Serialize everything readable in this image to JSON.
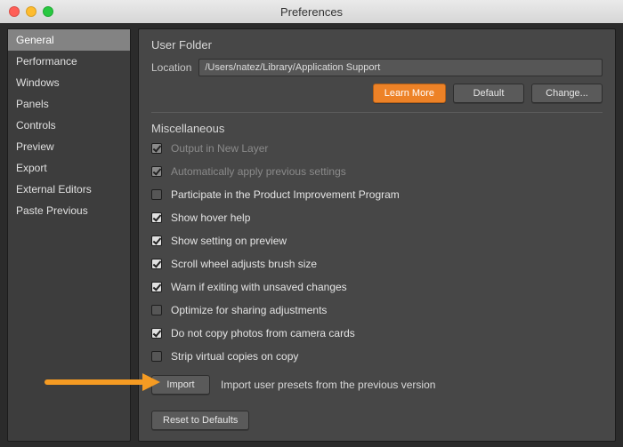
{
  "window": {
    "title": "Preferences"
  },
  "sidebar": {
    "items": [
      {
        "label": "General",
        "selected": true
      },
      {
        "label": "Performance"
      },
      {
        "label": "Windows"
      },
      {
        "label": "Panels"
      },
      {
        "label": "Controls"
      },
      {
        "label": "Preview"
      },
      {
        "label": "Export"
      },
      {
        "label": "External Editors"
      },
      {
        "label": "Paste Previous"
      }
    ]
  },
  "user_folder": {
    "heading": "User Folder",
    "location_label": "Location",
    "location_value": "/Users/natez/Library/Application Support",
    "learn_more": "Learn More",
    "default": "Default",
    "change": "Change..."
  },
  "misc": {
    "heading": "Miscellaneous",
    "items": [
      {
        "label": "Output in New Layer",
        "checked": true,
        "disabled": true
      },
      {
        "label": "Automatically apply previous settings",
        "checked": true,
        "disabled": true
      },
      {
        "label": "Participate in the Product Improvement Program",
        "checked": false
      },
      {
        "label": "Show hover help",
        "checked": true
      },
      {
        "label": "Show setting on preview",
        "checked": true
      },
      {
        "label": "Scroll wheel adjusts brush size",
        "checked": true
      },
      {
        "label": "Warn if exiting with unsaved changes",
        "checked": true
      },
      {
        "label": "Optimize for sharing adjustments",
        "checked": false
      },
      {
        "label": "Do not copy photos from camera cards",
        "checked": true
      },
      {
        "label": "Strip virtual copies on copy",
        "checked": false
      }
    ],
    "import_button": "Import",
    "import_hint": "Import user presets from the previous version",
    "reset": "Reset to Defaults"
  },
  "colors": {
    "accent": "#ed8227",
    "arrow": "#f59b23"
  }
}
